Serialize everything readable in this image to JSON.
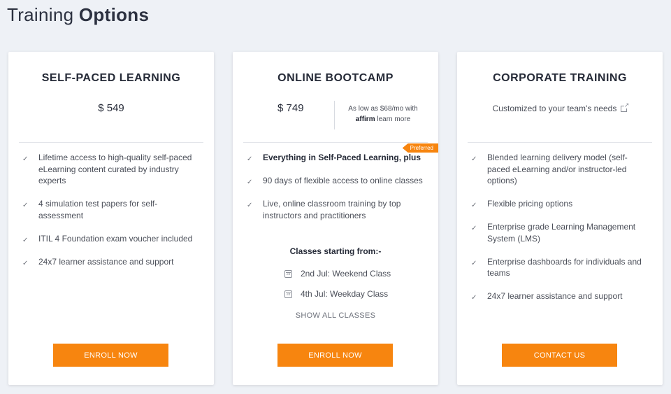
{
  "page": {
    "title_regular": "Training",
    "title_bold": "Options"
  },
  "colors": {
    "accent": "#f7850f",
    "background": "#eef1f6"
  },
  "cards": [
    {
      "title": "SELF-PACED LEARNING",
      "price": "$ 549",
      "features": [
        "Lifetime access to high-quality self-paced eLearning content curated by industry experts",
        "4 simulation test papers for self-assessment",
        "ITIL 4 Foundation exam voucher included",
        "24x7 learner assistance and support"
      ],
      "button": "ENROLL NOW"
    },
    {
      "title": "ONLINE BOOTCAMP",
      "price": "$ 749",
      "affirm_text": "As low as $68/mo with",
      "affirm_logo": "affirm",
      "affirm_link": "learn more",
      "badge": "Preferred",
      "features": [
        "Everything in Self-Paced Learning, plus",
        "90 days of flexible access to online classes",
        "Live, online classroom training by top instructors and practitioners"
      ],
      "classes_heading": "Classes starting from:-",
      "classes": [
        {
          "day": "28",
          "label": "2nd Jul: Weekend Class"
        },
        {
          "day": "28",
          "label": "4th Jul: Weekday Class"
        }
      ],
      "show_all": "SHOW ALL CLASSES",
      "button": "ENROLL NOW"
    },
    {
      "title": "CORPORATE TRAINING",
      "subtitle": "Customized to your team's needs",
      "subtitle_icon": "external-link-icon",
      "features": [
        "Blended learning delivery model (self-paced eLearning and/or instructor-led options)",
        "Flexible pricing options",
        "Enterprise grade Learning Management System (LMS)",
        "Enterprise dashboards for individuals and teams",
        "24x7 learner assistance and support"
      ],
      "button": "CONTACT US"
    }
  ]
}
